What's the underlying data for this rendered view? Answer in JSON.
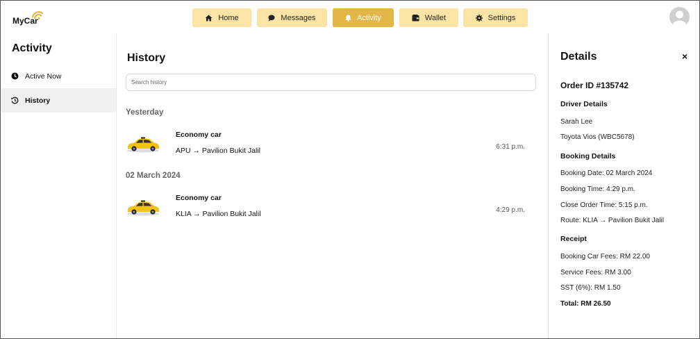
{
  "app": {
    "logo_text": "MyCar"
  },
  "nav": {
    "items": [
      {
        "label": "Home",
        "icon": "home-icon"
      },
      {
        "label": "Messages",
        "icon": "chat-bubble-icon"
      },
      {
        "label": "Activity",
        "icon": "bell-icon",
        "active": true
      },
      {
        "label": "Wallet",
        "icon": "wallet-icon"
      },
      {
        "label": "Settings",
        "icon": "gear-icon"
      }
    ]
  },
  "colors": {
    "nav_bg": "#fbe4a6",
    "nav_active": "#e2b647",
    "car_yellow": "#f2c21b"
  },
  "sidebar": {
    "title": "Activity",
    "items": [
      {
        "label": "Active Now",
        "icon": "clock-icon"
      },
      {
        "label": "History",
        "icon": "history-icon",
        "active": true
      }
    ]
  },
  "main": {
    "title": "History",
    "search_placeholder": "Search history",
    "groups": [
      {
        "label": "Yesterday",
        "trips": [
          {
            "title": "Economy car",
            "route": "APU → Pavilion Bukit Jalil",
            "time": "6:31 p.m."
          }
        ]
      },
      {
        "label": "02 March 2024",
        "trips": [
          {
            "title": "Economy car",
            "route": "KLIA → Pavilion Bukit Jalil",
            "time": "4:29 p.m."
          }
        ]
      }
    ]
  },
  "details": {
    "title": "Details",
    "close": "×",
    "order_id": "Order ID #135742",
    "driver_heading": "Driver Details",
    "driver_name": "Sarah Lee",
    "vehicle": "Toyota Vios (WBC5678)",
    "booking_heading": "Booking Details",
    "booking_date": "Booking Date: 02 March 2024",
    "booking_time": "Booking Time: 4:29 p.m.",
    "close_order_time": "Close Order Time: 5:15 p.m.",
    "route": "Route: KLIA → Pavilion Bukit Jalil",
    "receipt_heading": "Receipt",
    "booking_fees": "Booking Car Fees: RM 22.00",
    "service_fees": "Service Fees: RM 3.00",
    "sst": "SST (6%): RM 1.50",
    "total": "Total: RM 26.50"
  }
}
